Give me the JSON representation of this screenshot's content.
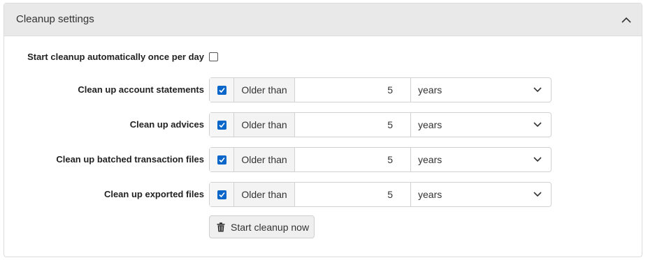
{
  "panel": {
    "title": "Cleanup settings",
    "auto_cleanup_label": "Start cleanup automatically once per day",
    "auto_cleanup_checked": false
  },
  "rows": [
    {
      "label": "Clean up account statements",
      "checked": true,
      "prefix": "Older than",
      "value": "5",
      "unit": "years"
    },
    {
      "label": "Clean up advices",
      "checked": true,
      "prefix": "Older than",
      "value": "5",
      "unit": "years"
    },
    {
      "label": "Clean up batched transaction files",
      "checked": true,
      "prefix": "Older than",
      "value": "5",
      "unit": "years"
    },
    {
      "label": "Clean up exported files",
      "checked": true,
      "prefix": "Older than",
      "value": "5",
      "unit": "years"
    }
  ],
  "button": {
    "label": "Start cleanup now",
    "icon": "trash-icon"
  },
  "colors": {
    "accent": "#0a66c8",
    "header_bg": "#e9e9e9",
    "border": "#dcdcdc"
  }
}
